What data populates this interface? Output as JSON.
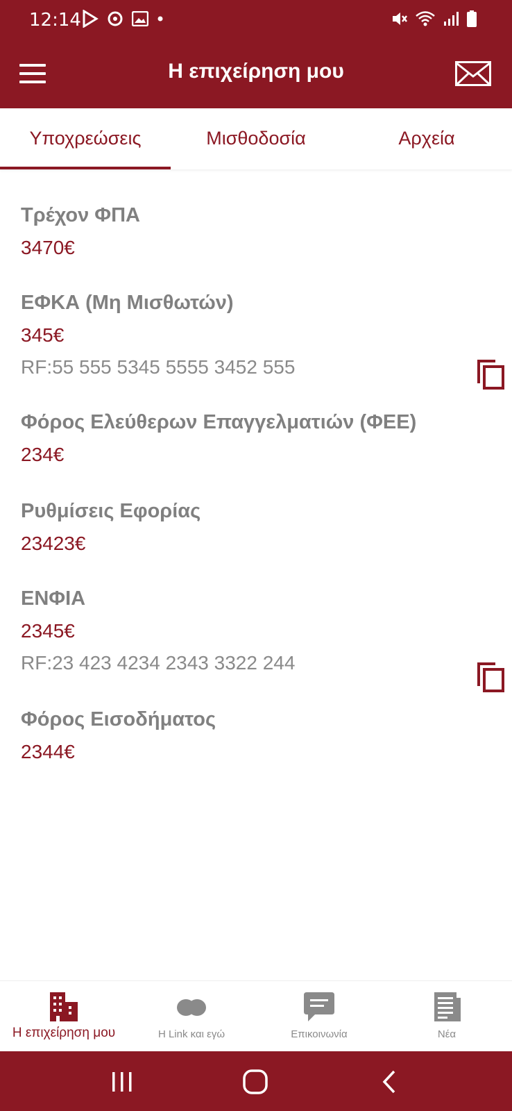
{
  "status_bar": {
    "time": "12:14"
  },
  "app_bar": {
    "title": "Η επιχείρηση μου"
  },
  "tabs": [
    {
      "label": "Υποχρεώσεις",
      "active": true
    },
    {
      "label": "Μισθοδοσία",
      "active": false
    },
    {
      "label": "Αρχεία",
      "active": false
    }
  ],
  "obligations": [
    {
      "title": "Τρέχον ΦΠΑ",
      "amount": "3470€"
    },
    {
      "title": "ΕΦΚΑ (Μη Μισθωτών)",
      "amount": "345€",
      "ref": "RF:55 555 5345 5555 3452 555"
    },
    {
      "title": "Φόρος Ελεύθερων Επαγγελματιών (ΦΕΕ)",
      "amount": "234€"
    },
    {
      "title": "Ρυθμίσεις Εφορίας",
      "amount": "23423€"
    },
    {
      "title": "ΕΝΦΙΑ",
      "amount": "2345€",
      "ref": "RF:23 423 4234 2343 3322 244"
    },
    {
      "title": "Φόρος Εισοδήματος",
      "amount": "2344€"
    }
  ],
  "bottom_nav": [
    {
      "label": "Η επιχείρηση μου",
      "icon": "building-icon",
      "active": true
    },
    {
      "label": "Η Link και εγώ",
      "icon": "link-icon",
      "active": false
    },
    {
      "label": "Επικοινωνία",
      "icon": "chat-icon",
      "active": false
    },
    {
      "label": "Νέα",
      "icon": "news-icon",
      "active": false
    }
  ],
  "colors": {
    "primary": "#8b1823",
    "text_gray": "#808080",
    "icon_gray": "#8a8a8a"
  }
}
